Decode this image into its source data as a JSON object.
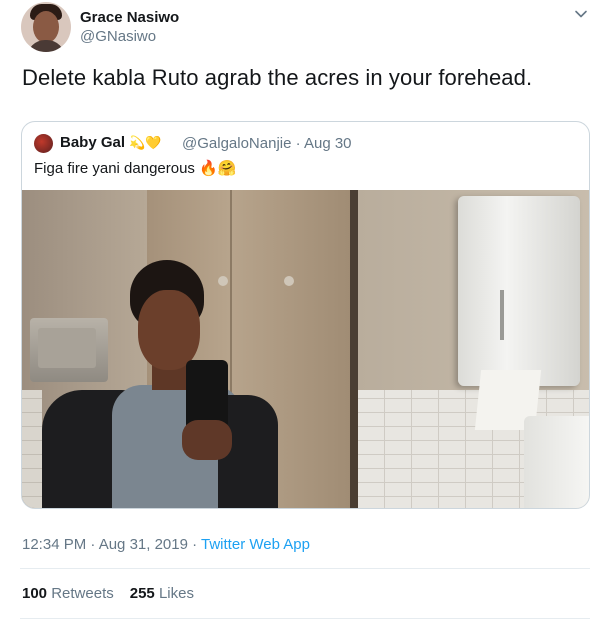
{
  "author": {
    "name": "Grace Nasiwo",
    "handle": "@GNasiwo"
  },
  "tweet": {
    "text": "Delete kabla Ruto agrab the acres in your forehead."
  },
  "quoted_tweet": {
    "name": "Baby Gal",
    "name_emojis": "💫💛",
    "handle": "@GalgaloNanjie",
    "separator": "·",
    "date": "Aug 30",
    "text": "Figa fire yani dangerous 🔥🤗"
  },
  "meta": {
    "timestamp": "12:34 PM · Aug 31, 2019 · ",
    "source": "Twitter Web App"
  },
  "stats": {
    "retweets_count": "100",
    "retweets_label": "Retweets",
    "likes_count": "255",
    "likes_label": "Likes"
  },
  "colors": {
    "link": "#1da1f2",
    "secondary_text": "#657786",
    "primary_text": "#14171a",
    "border": "#ccd6dd"
  },
  "icons": {
    "menu": "chevron-down-icon"
  }
}
